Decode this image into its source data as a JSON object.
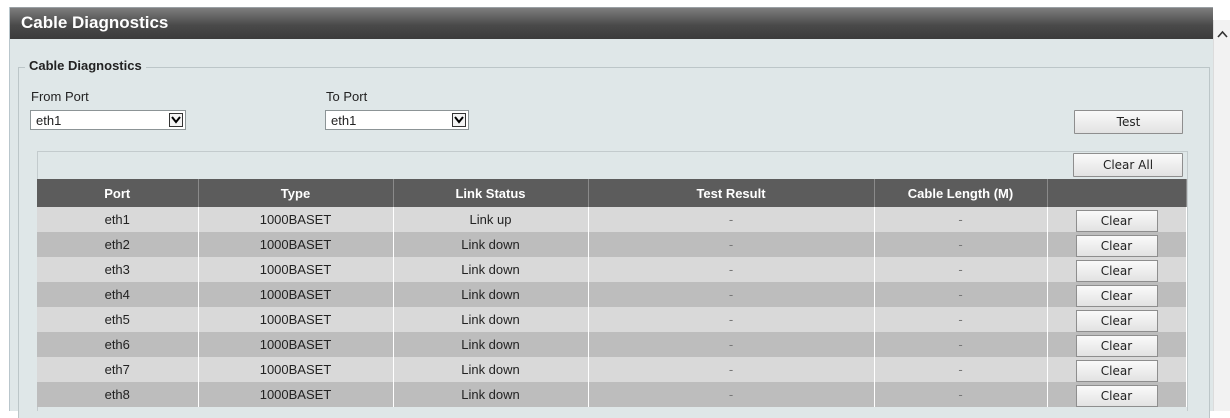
{
  "title": "Cable Diagnostics",
  "section_legend": "Cable Diagnostics",
  "from_port": {
    "label": "From Port",
    "value": "eth1"
  },
  "to_port": {
    "label": "To Port",
    "value": "eth1"
  },
  "buttons": {
    "test": "Test",
    "clear_all": "Clear All"
  },
  "table": {
    "columns": [
      "Port",
      "Type",
      "Link Status",
      "Test Result",
      "Cable Length (M)",
      ""
    ],
    "rows": [
      {
        "port": "eth1",
        "type": "1000BASET",
        "link_status": "Link up",
        "test_result": "-",
        "cable_length": "-",
        "action": "Clear"
      },
      {
        "port": "eth2",
        "type": "1000BASET",
        "link_status": "Link down",
        "test_result": "-",
        "cable_length": "-",
        "action": "Clear"
      },
      {
        "port": "eth3",
        "type": "1000BASET",
        "link_status": "Link down",
        "test_result": "-",
        "cable_length": "-",
        "action": "Clear"
      },
      {
        "port": "eth4",
        "type": "1000BASET",
        "link_status": "Link down",
        "test_result": "-",
        "cable_length": "-",
        "action": "Clear"
      },
      {
        "port": "eth5",
        "type": "1000BASET",
        "link_status": "Link down",
        "test_result": "-",
        "cable_length": "-",
        "action": "Clear"
      },
      {
        "port": "eth6",
        "type": "1000BASET",
        "link_status": "Link down",
        "test_result": "-",
        "cable_length": "-",
        "action": "Clear"
      },
      {
        "port": "eth7",
        "type": "1000BASET",
        "link_status": "Link down",
        "test_result": "-",
        "cable_length": "-",
        "action": "Clear"
      },
      {
        "port": "eth8",
        "type": "1000BASET",
        "link_status": "Link down",
        "test_result": "-",
        "cable_length": "-",
        "action": "Clear"
      }
    ]
  },
  "icons": {
    "dropdown": "chevron-down-icon",
    "scroll_up": "chevron-up-icon"
  }
}
